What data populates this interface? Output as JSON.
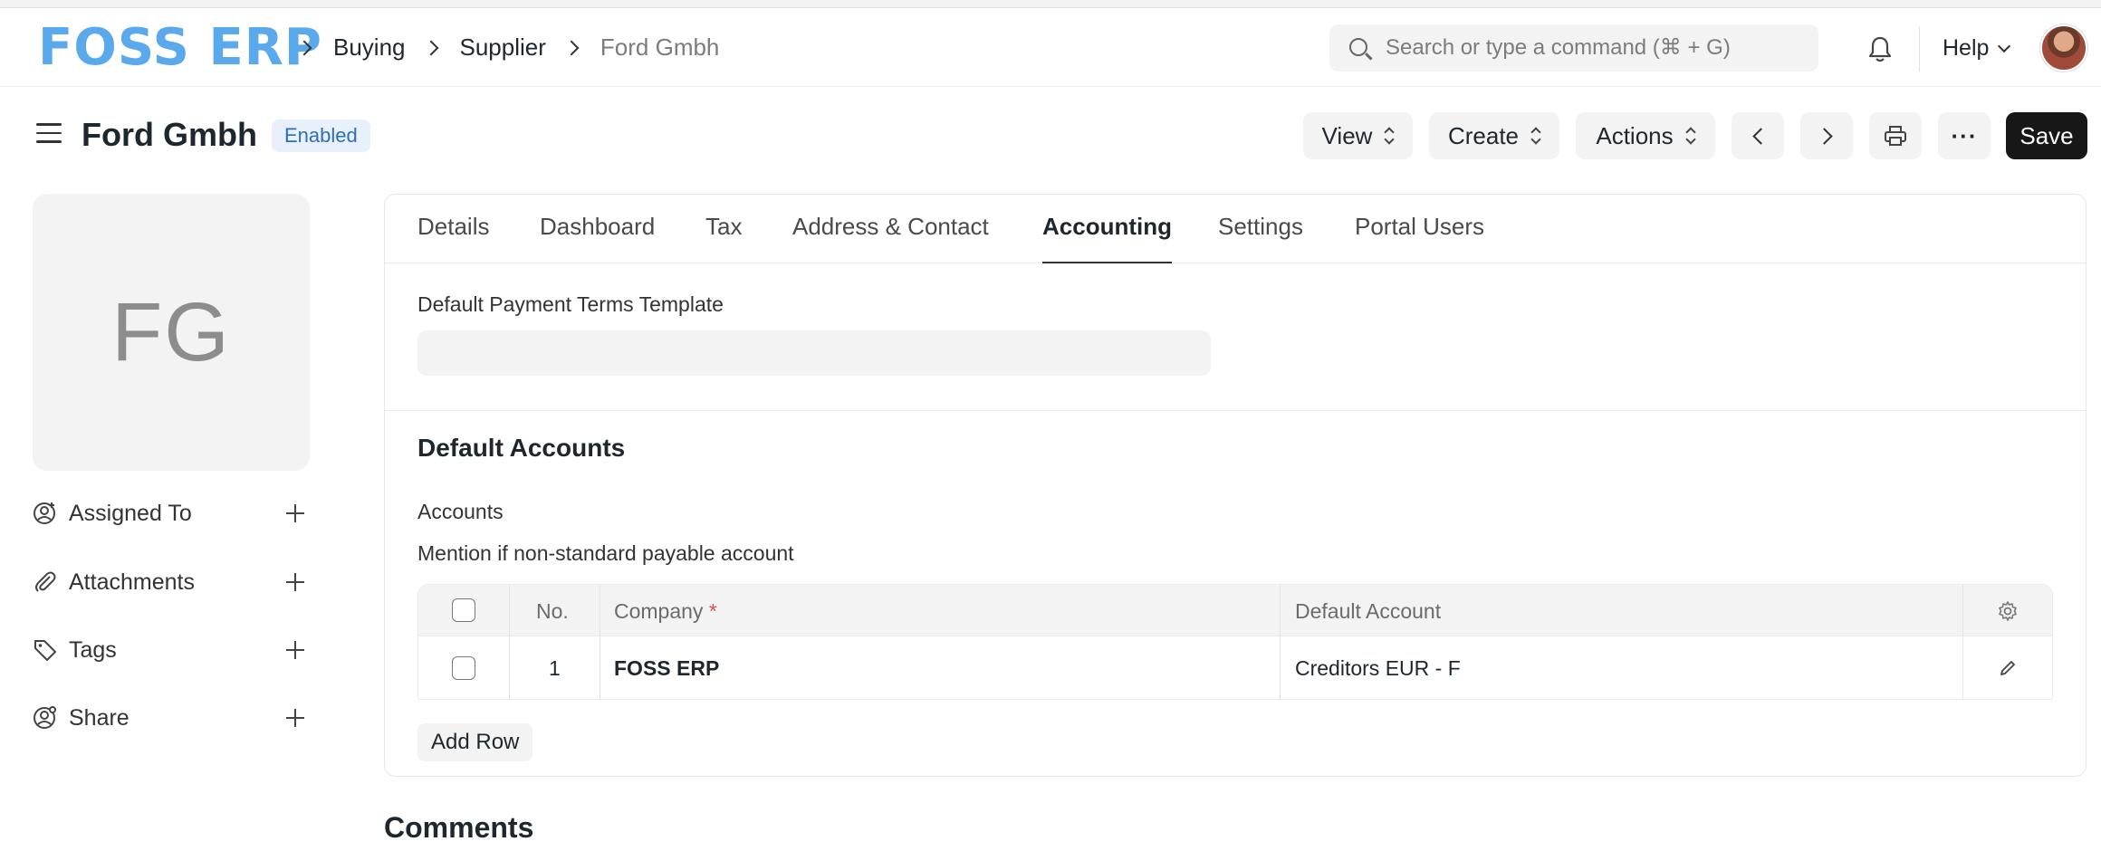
{
  "navbar": {
    "logo": "FOSS ERP",
    "breadcrumbs": [
      "Buying",
      "Supplier",
      "Ford Gmbh"
    ],
    "search_placeholder": "Search or type a command (⌘ + G)",
    "help_label": "Help"
  },
  "page": {
    "title": "Ford Gmbh",
    "status": "Enabled",
    "buttons": {
      "view": "View",
      "create": "Create",
      "actions": "Actions",
      "more": "···",
      "save": "Save"
    }
  },
  "sidebar": {
    "initials": "FG",
    "items": [
      {
        "label": "Assigned To",
        "icon": "user-plus-icon"
      },
      {
        "label": "Attachments",
        "icon": "paperclip-icon"
      },
      {
        "label": "Tags",
        "icon": "tag-icon"
      },
      {
        "label": "Share",
        "icon": "share-user-icon"
      }
    ]
  },
  "tabs": [
    "Details",
    "Dashboard",
    "Tax",
    "Address & Contact",
    "Accounting",
    "Settings",
    "Portal Users"
  ],
  "active_tab": "Accounting",
  "form": {
    "payment_terms_label": "Default Payment Terms Template",
    "payment_terms_value": "",
    "section_title": "Default Accounts",
    "accounts_label": "Accounts",
    "accounts_description": "Mention if non-standard payable account",
    "grid": {
      "headers": {
        "no": "No.",
        "company": "Company",
        "required_mark": "*",
        "default_account": "Default Account"
      },
      "rows": [
        {
          "no": "1",
          "company": "FOSS ERP",
          "default_account": "Creditors EUR - F"
        }
      ]
    },
    "add_row": "Add Row"
  },
  "comments_title": "Comments",
  "colors": {
    "logo": "#5aa9ec",
    "status_badge_bg": "#e8f1fb",
    "status_badge_text": "#2c6fb7",
    "save_button": "#171717",
    "required": "#e24c4c"
  }
}
